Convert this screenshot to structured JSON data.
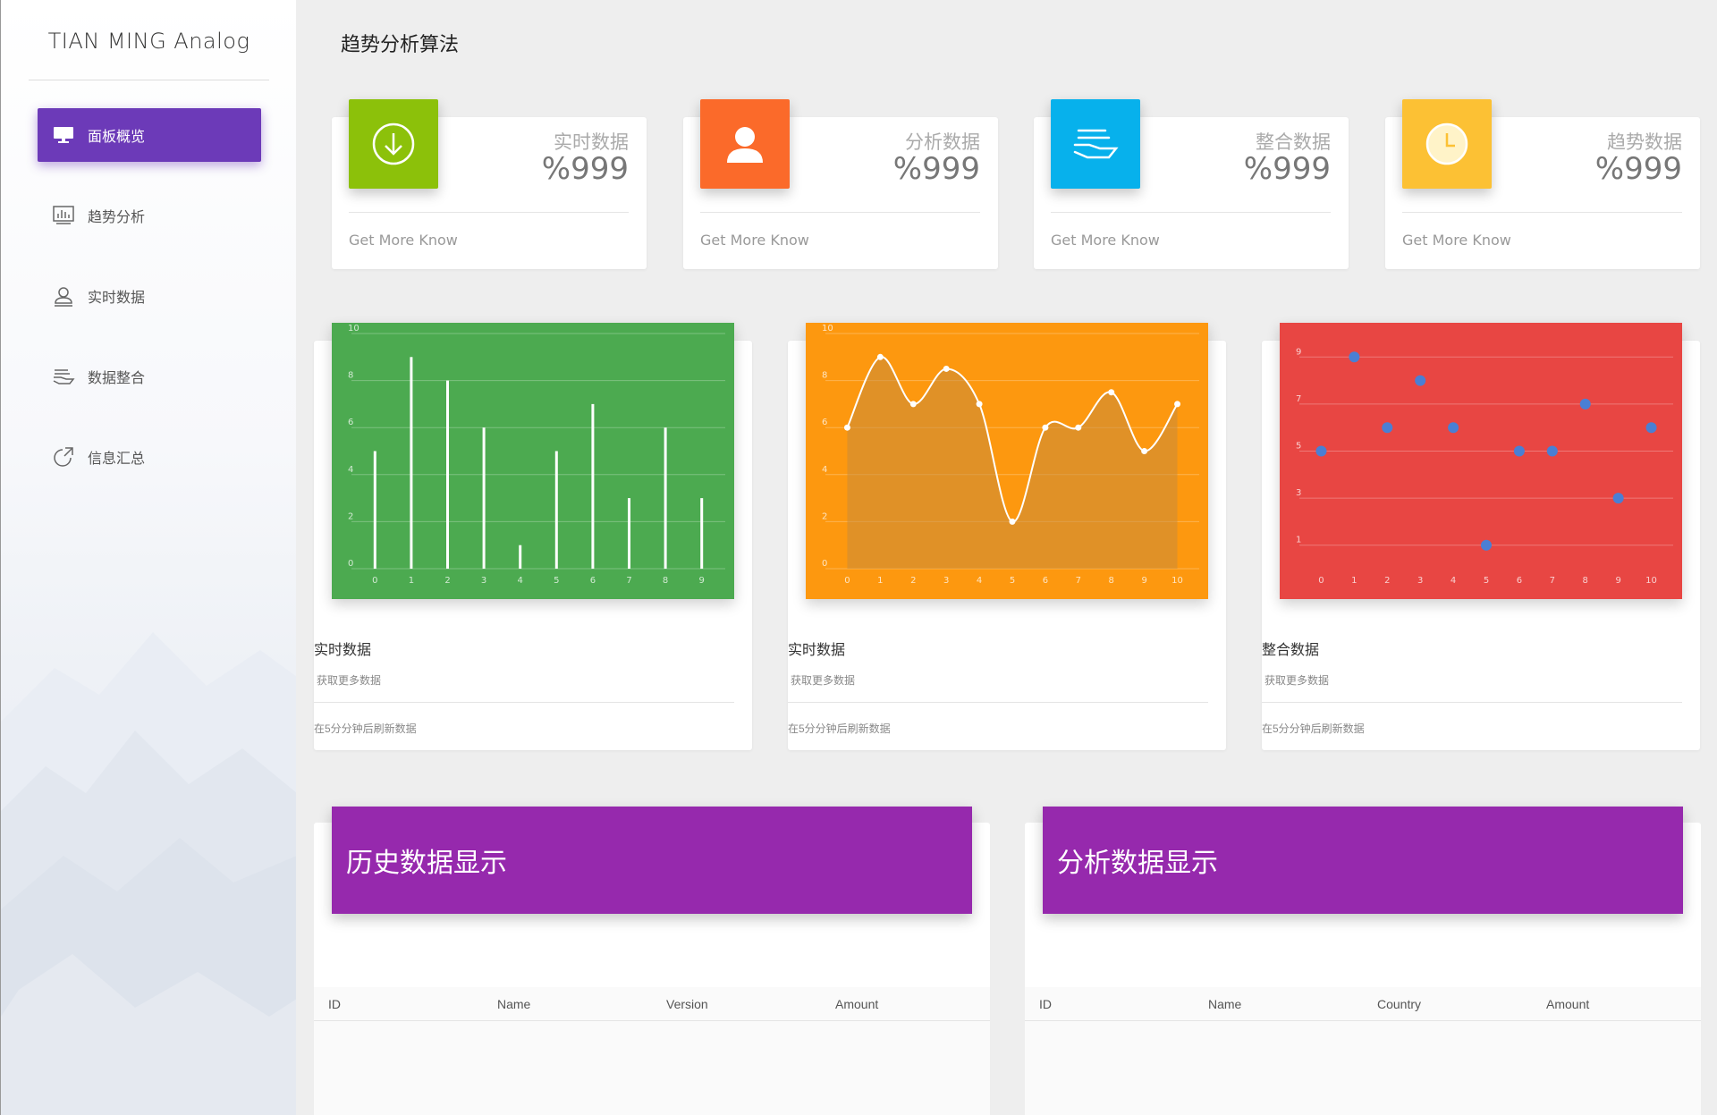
{
  "brand": "TIAN MING Analog",
  "page_title": "趋势分析算法",
  "nav": [
    {
      "label": "面板概览",
      "icon": "monitor-icon",
      "active": true
    },
    {
      "label": "趋势分析",
      "icon": "bar-chart-icon",
      "active": false
    },
    {
      "label": "实时数据",
      "icon": "user-icon",
      "active": false
    },
    {
      "label": "数据整合",
      "icon": "hand-money-icon",
      "active": false
    },
    {
      "label": "信息汇总",
      "icon": "share-icon",
      "active": false
    }
  ],
  "stats": [
    {
      "label": "实时数据",
      "value": "%999",
      "more": "Get More Know",
      "color": "#8cc10a",
      "icon": "download-circle-icon"
    },
    {
      "label": "分析数据",
      "value": "%999",
      "more": "Get More Know",
      "color": "#fb6a2a",
      "icon": "user-icon"
    },
    {
      "label": "整合数据",
      "value": "%999",
      "more": "Get More Know",
      "color": "#07b1ec",
      "icon": "hand-money-icon"
    },
    {
      "label": "趋势数据",
      "value": "%999",
      "more": "Get More Know",
      "color": "#fcc134",
      "icon": "clock-icon"
    }
  ],
  "cards": [
    {
      "title": "实时数据",
      "sub": "获取更多数据",
      "foot": "在5分分钟后刷新数据",
      "color": "#4caa50"
    },
    {
      "title": "实时数据",
      "sub": "获取更多数据",
      "foot": "在5分分钟后刷新数据",
      "color": "#fd980f"
    },
    {
      "title": "整合数据",
      "sub": "获取更多数据",
      "foot": "在5分分钟后刷新数据",
      "color": "#e84643"
    }
  ],
  "chart_data": [
    {
      "type": "bar",
      "categories": [
        "0",
        "1",
        "2",
        "3",
        "4",
        "5",
        "6",
        "7",
        "8",
        "9"
      ],
      "values": [
        5,
        9,
        8,
        6,
        1,
        5,
        7,
        3,
        6,
        3
      ],
      "ylim": [
        0,
        10
      ],
      "yticks": [
        0,
        2,
        4,
        6,
        8,
        10
      ],
      "grid": true
    },
    {
      "type": "area",
      "x": [
        0,
        1,
        2,
        3,
        4,
        5,
        6,
        7,
        8,
        9,
        10
      ],
      "values": [
        6,
        9,
        7,
        8.5,
        7,
        2,
        6,
        6,
        7.5,
        5,
        7
      ],
      "ylim": [
        0,
        10
      ],
      "yticks": [
        0,
        2,
        4,
        6,
        8,
        10
      ],
      "grid": true
    },
    {
      "type": "scatter",
      "x": [
        0,
        1,
        2,
        3,
        4,
        5,
        6,
        7,
        8,
        9,
        10
      ],
      "values": [
        5,
        9,
        6,
        8,
        6,
        1,
        5,
        5,
        7,
        3,
        6
      ],
      "ylim": [
        0,
        10
      ],
      "yticks": [
        1,
        3,
        5,
        7,
        9
      ],
      "grid": true
    }
  ],
  "tables": [
    {
      "title": "历史数据显示",
      "columns": [
        "ID",
        "Name",
        "Version",
        "Amount"
      ]
    },
    {
      "title": "分析数据显示",
      "columns": [
        "ID",
        "Name",
        "Country",
        "Amount"
      ]
    }
  ]
}
